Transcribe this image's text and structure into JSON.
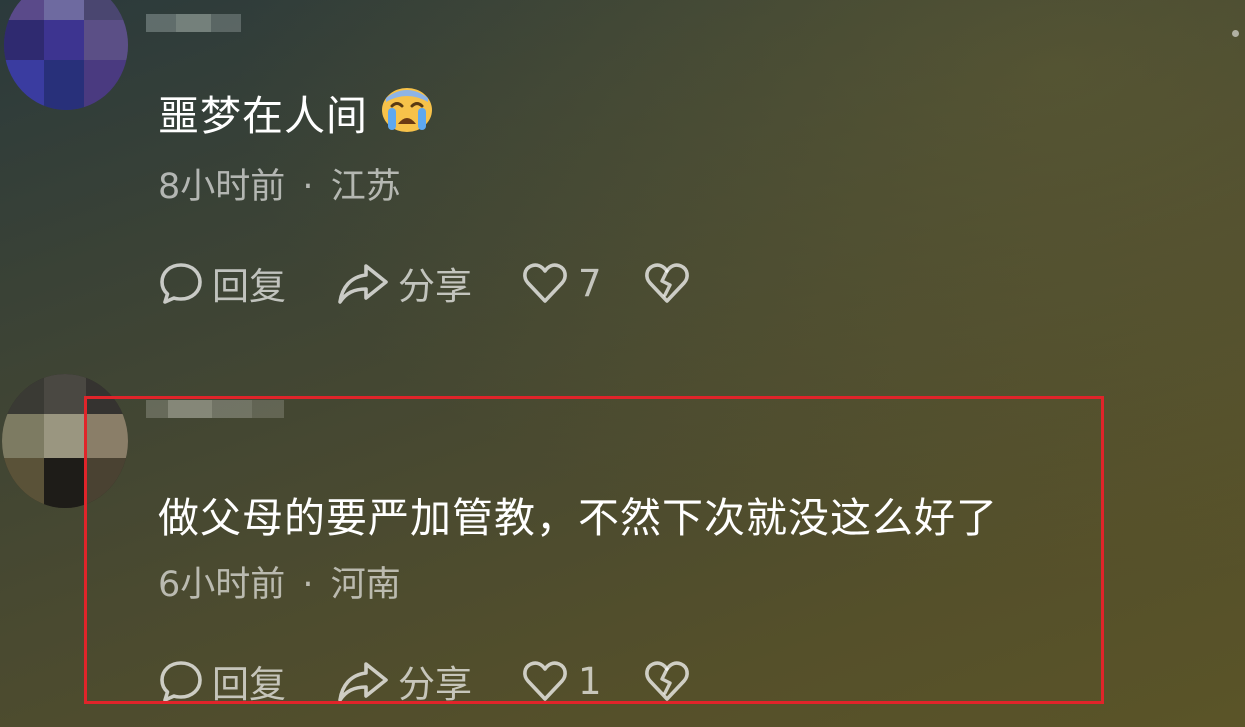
{
  "comments": [
    {
      "text": "噩梦在人间",
      "emoji": "crying-face",
      "time": "8小时前",
      "separator": "·",
      "location": "江苏",
      "reply_label": "回复",
      "share_label": "分享",
      "like_count": "7",
      "highlighted": false
    },
    {
      "text": "做父母的要严加管教，不然下次就没这么好了",
      "time": "6小时前",
      "separator": "·",
      "location": "河南",
      "reply_label": "回复",
      "share_label": "分享",
      "like_count": "1",
      "highlighted": true
    }
  ],
  "icons": {
    "reply": "speech-bubble-icon",
    "share": "share-arrow-icon",
    "like": "heart-icon",
    "dislike": "broken-heart-icon"
  },
  "colors": {
    "highlight_border": "#e0242a",
    "text_primary": "#ffffff",
    "text_secondary": "rgba(255,255,255,0.62)"
  }
}
